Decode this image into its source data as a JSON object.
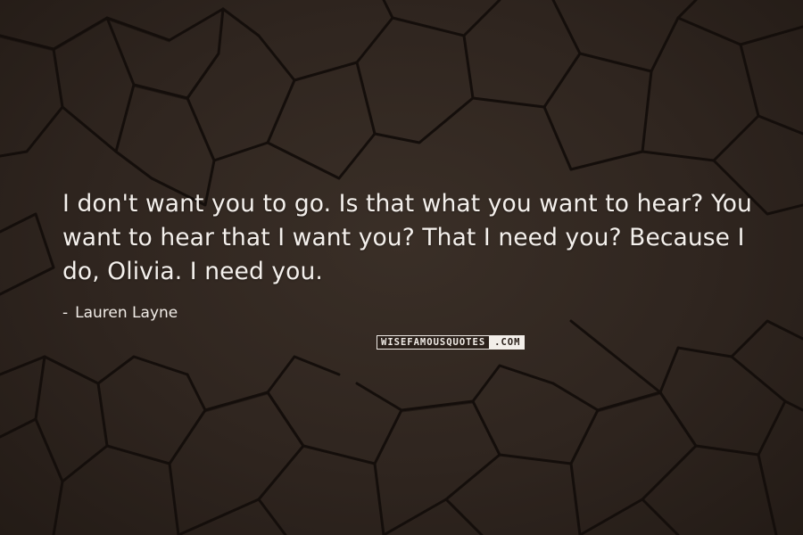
{
  "quote": {
    "text": "I don't want you to go. Is that what you want to hear? You want to hear that I want you? That I need you? Because I do, Olivia. I need you.",
    "author_dash": "-",
    "author": "Lauren Layne"
  },
  "watermark": {
    "left": "WISEFAMOUSQUOTES",
    "right": ".COM"
  },
  "colors": {
    "background": "#2e241e",
    "crack": "#140e0b",
    "text": "#f4f0ec"
  }
}
